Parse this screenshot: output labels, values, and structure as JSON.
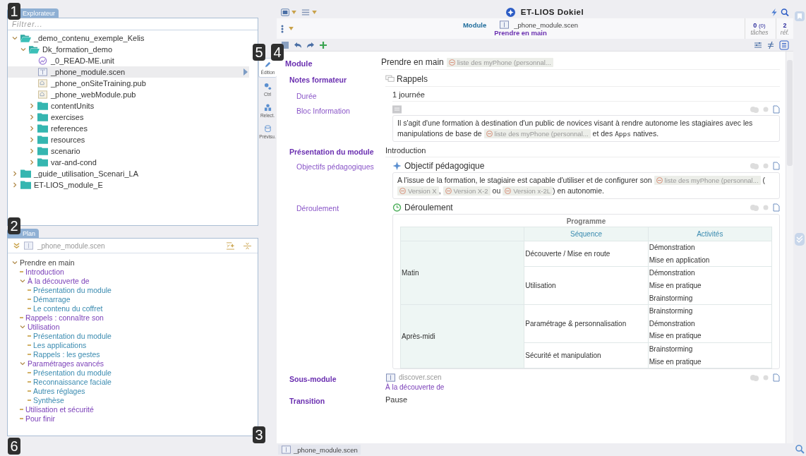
{
  "callouts": [
    "1",
    "2",
    "3",
    "4",
    "5",
    "6"
  ],
  "explorer": {
    "tab": "Explorateur",
    "filter_placeholder": "Filtrer...",
    "tree": [
      {
        "label": "_demo_contenu_exemple_Kelis",
        "kind": "folder",
        "expanded": true,
        "selected": false,
        "children": [
          {
            "label": "Dk_formation_demo",
            "kind": "folder",
            "expanded": true,
            "selected": false,
            "children": [
              {
                "label": "_0_READ-ME.unit",
                "kind": "unit",
                "selected": false
              },
              {
                "label": "_phone_module.scen",
                "kind": "scen",
                "selected": true
              },
              {
                "label": "_phone_onSiteTraining.pub",
                "kind": "pub",
                "selected": false
              },
              {
                "label": "_phone_webModule.pub",
                "kind": "pub",
                "selected": false
              },
              {
                "label": "contentUnits",
                "kind": "folder",
                "expanded": false,
                "selected": false
              },
              {
                "label": "exercises",
                "kind": "folder",
                "expanded": false,
                "selected": false
              },
              {
                "label": "references",
                "kind": "folder",
                "expanded": false,
                "selected": false
              },
              {
                "label": "resources",
                "kind": "folder",
                "expanded": false,
                "selected": false
              },
              {
                "label": "scenario",
                "kind": "folder",
                "expanded": false,
                "selected": false
              },
              {
                "label": "var-and-cond",
                "kind": "folder",
                "expanded": false,
                "selected": false
              }
            ]
          }
        ]
      },
      {
        "label": "_guide_utilisation_Scenari_LA",
        "kind": "folder",
        "expanded": false,
        "selected": false
      },
      {
        "label": "ET-LIOS_module_E",
        "kind": "folder",
        "expanded": false,
        "selected": false
      }
    ]
  },
  "plan": {
    "tab": "Plan",
    "file": "_phone_module.scen",
    "tree": [
      {
        "label": "Prendre en main",
        "expanded": true,
        "children": [
          {
            "label": "Introduction"
          },
          {
            "label": "À la découverte de",
            "expanded": true,
            "children": [
              {
                "label": "Présentation du module"
              },
              {
                "label": "Démarrage"
              },
              {
                "label": "Le contenu du coffret"
              }
            ]
          },
          {
            "label": "Rappels : connaître son"
          },
          {
            "label": "Utilisation",
            "expanded": true,
            "children": [
              {
                "label": "Présentation du module"
              },
              {
                "label": "Les applications"
              },
              {
                "label": "Rappels : les gestes"
              }
            ]
          },
          {
            "label": "Paramétrages avancés",
            "expanded": true,
            "children": [
              {
                "label": "Présentation du module"
              },
              {
                "label": "Reconnaissance faciale"
              },
              {
                "label": "Autres réglages"
              },
              {
                "label": "Synthèse"
              }
            ]
          },
          {
            "label": "Utilisation et sécurité"
          },
          {
            "label": "Pour finir"
          }
        ]
      }
    ]
  },
  "side_tabs": [
    {
      "label": "Édition",
      "selected": true
    },
    {
      "label": "Ctrl",
      "selected": false
    },
    {
      "label": "Relect.",
      "selected": false
    },
    {
      "label": "Prévisu.",
      "selected": false
    }
  ],
  "header": {
    "title": "ET-LIOS Dokiel",
    "module_label": "Module",
    "file": "_phone_module.scen",
    "subtitle": "Prendre en main",
    "tasks_count": "0",
    "tasks_open": "(0)",
    "tasks_label": "tâches",
    "refs_count": "2",
    "refs_label": "réf."
  },
  "document": {
    "module": {
      "label": "Module",
      "title": "Prendre en main",
      "ref": "liste des myPhone (personnal..."
    },
    "notes": {
      "label": "Notes formateur",
      "title": "Rappels",
      "duration_label": "Durée",
      "duration": "1 journée",
      "info_label": "Bloc Information",
      "info_text": [
        {
          "kind": "text",
          "text": "Il s'agit d'une formation à destination d'un public de novices visant à rendre autonome les stagiaires avec les manipulations de base de "
        },
        {
          "kind": "ref",
          "text": "liste des myPhone (personnal..."
        },
        {
          "kind": "text",
          "text": " et des "
        },
        {
          "kind": "code",
          "text": "Apps"
        },
        {
          "kind": "text",
          "text": " natives."
        }
      ]
    },
    "presentation": {
      "label": "Présentation du module",
      "title": "Introduction",
      "objectives_label": "Objectifs pédagogiques",
      "objectives_title": "Objectif pédagogique",
      "objectives_text": [
        {
          "kind": "text",
          "text": "A l'issue de la formation, le stagiaire est capable d'utiliser et de configurer son "
        },
        {
          "kind": "ref",
          "text": "liste des myPhone (personnal..."
        },
        {
          "kind": "text",
          "text": " ( "
        },
        {
          "kind": "ref",
          "text": "Version X"
        },
        {
          "kind": "text",
          "text": ", "
        },
        {
          "kind": "ref",
          "text": "Version X-2"
        },
        {
          "kind": "text",
          "text": " ou "
        },
        {
          "kind": "ref",
          "text": "Version x-2L"
        },
        {
          "kind": "text",
          "text": ") en autonomie."
        }
      ],
      "progress_label": "Déroulement",
      "progress_title": "Déroulement",
      "table": {
        "caption": "Programme",
        "columns": [
          "Séquence",
          "Activités"
        ],
        "groups": [
          {
            "period": "Matin",
            "sequences": [
              {
                "name": "Découverte / Mise en route",
                "activities": [
                  "Démonstration",
                  "Mise en application"
                ]
              },
              {
                "name": "Utilisation",
                "activities": [
                  "Démonstration",
                  "Mise en pratique",
                  "Brainstorming"
                ]
              }
            ]
          },
          {
            "period": "Après-midi",
            "sequences": [
              {
                "name": "Paramétrage & personnalisation",
                "activities": [
                  "Brainstorming",
                  "Démonstration",
                  "Mise en pratique"
                ]
              },
              {
                "name": "Sécurité et manipulation",
                "activities": [
                  "Brainstorming",
                  "Mise en pratique"
                ]
              }
            ]
          }
        ]
      }
    },
    "submodule": {
      "label": "Sous-module",
      "file": "discover.scen",
      "title": "À la découverte de"
    },
    "transition": {
      "label": "Transition",
      "title": "Pause"
    }
  },
  "bottom_tab": "_phone_module.scen"
}
